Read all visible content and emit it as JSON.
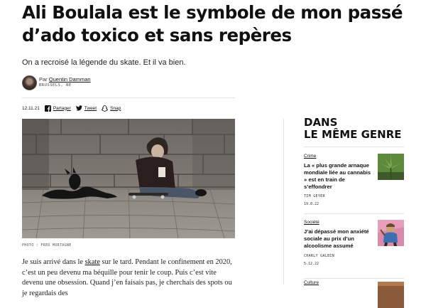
{
  "article": {
    "headline": "Ali Boulala est le symbole de mon passé d’ado toxico et sans repères",
    "standfirst": "On a recroisé la légende du skate. Et il va bien.",
    "byline": {
      "prefix": "Par",
      "author": "Quentin Damman",
      "location": "BRUSSELS, BE"
    },
    "date": "12.11.21",
    "share": {
      "facebook": "Partager",
      "twitter": "Tweet",
      "snapchat": "Snap"
    },
    "photo_caption": "PHOTO : FRED MORTAGNE",
    "body": {
      "start": "Je suis arrivé dans le ",
      "link": "skate",
      "rest": " sur le tard. Pendant le confinement en 2020, c’est un peu devenu ma béquille pour tenir le coup. Puis c’est vite devenu une obsession. Quand j’en faisais pas, je cherchais des spots ou je regardais des"
    }
  },
  "sidebar": {
    "title_line1": "DANS",
    "title_line2": "LE MÊME GENRE",
    "items": [
      {
        "category": "Crime",
        "headline": "La « plus grande arnaque mondiale liée au cannabis » est en train de s’effondrer",
        "author": "TIM GEYER",
        "date": "19.8.22"
      },
      {
        "category": "Société",
        "headline": "J’ai dépassé mon anxiété sociale au prix d’un alcoolisme assumé",
        "author": "CHARLY GALBIN",
        "date": "5.12.22"
      },
      {
        "category": "Culture"
      }
    ]
  },
  "colors": {
    "text": "#111111",
    "rule": "#e3e3e3",
    "caption": "#555555"
  },
  "icons": [
    "facebook-icon",
    "twitter-icon",
    "snapchat-icon"
  ]
}
